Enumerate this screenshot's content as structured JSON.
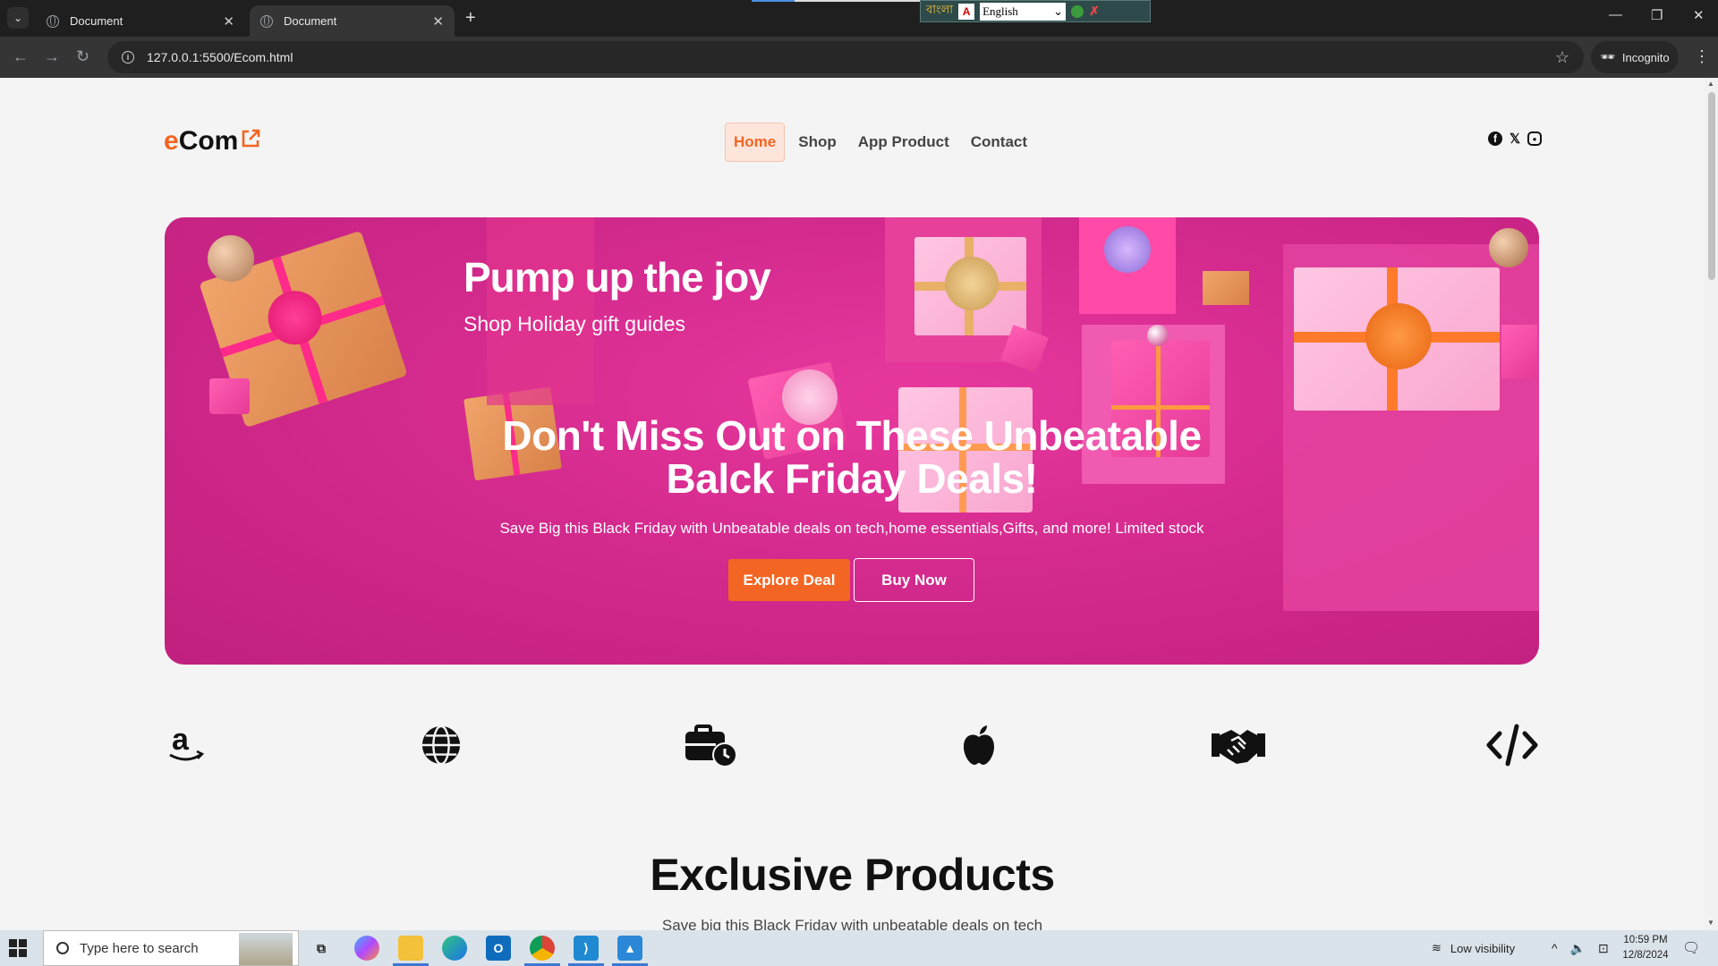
{
  "browser": {
    "tabs": [
      {
        "title": "Document"
      },
      {
        "title": "Document"
      }
    ],
    "url": "127.0.0.1:5500/Ecom.html",
    "profile": "Incognito",
    "ime": {
      "script_label": "বাংলা",
      "language": "English"
    }
  },
  "site": {
    "logo_prefix": "e",
    "logo_rest": "Com",
    "nav": [
      {
        "label": "Home",
        "active": true
      },
      {
        "label": "Shop",
        "active": false
      },
      {
        "label": "App Product",
        "active": false
      },
      {
        "label": "Contact",
        "active": false
      }
    ],
    "social_icons": [
      "facebook-icon",
      "x-twitter-icon",
      "instagram-icon"
    ]
  },
  "hero": {
    "banner_title": "Pump up the joy",
    "banner_subtitle": "Shop Holiday gift guides",
    "headline_line1": "Don't Miss Out on These Unbeatable",
    "headline_line2": "Balck Friday Deals!",
    "description": "Save Big this Black Friday with Unbeatable deals on tech,home essentials,Gifts, and more! Limited stock",
    "primary_button": "Explore Deal",
    "secondary_button": "Buy Now"
  },
  "brand_icons": [
    "amazon-icon",
    "globe-icon",
    "briefcase-clock-icon",
    "apple-icon",
    "handshake-icon",
    "code-icon"
  ],
  "products": {
    "title": "Exclusive Products",
    "subtitle": "Save big this Black Friday with unbeatable deals on tech"
  },
  "taskbar": {
    "search_placeholder": "Type here to search",
    "weather": "Low visibility",
    "time": "10:59 PM",
    "date": "12/8/2024"
  },
  "colors": {
    "accent": "#f26522",
    "hero_pink": "#d42a8e",
    "nav_active_bg": "#fde5dc"
  }
}
